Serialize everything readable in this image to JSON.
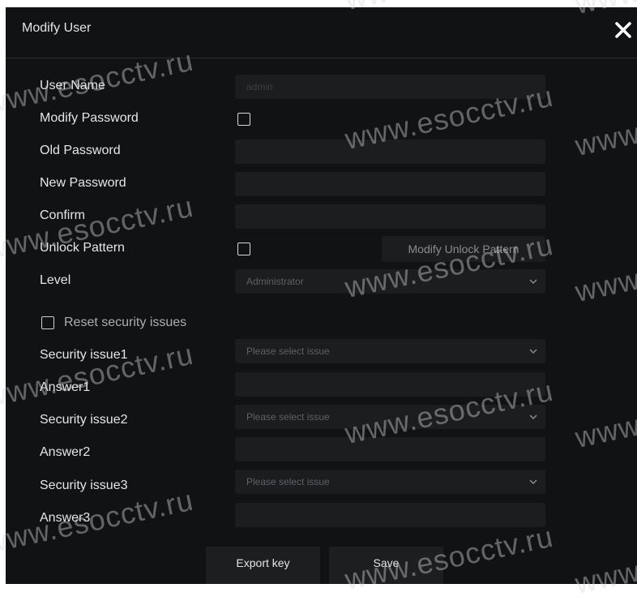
{
  "dialog": {
    "title": "Modify User",
    "fields": {
      "user_name": {
        "label": "User Name",
        "value": "admin"
      },
      "modify_password": {
        "label": "Modify Password"
      },
      "old_password": {
        "label": "Old Password",
        "value": ""
      },
      "new_password": {
        "label": "New Password",
        "value": ""
      },
      "confirm": {
        "label": "Confirm",
        "value": ""
      },
      "unlock_pattern": {
        "label": "Unlock Pattern",
        "button_label": "Modify Unlock Pattern"
      },
      "level": {
        "label": "Level",
        "value": "Administrator"
      },
      "reset_security": {
        "label": "Reset security issues"
      },
      "security_issue1": {
        "label": "Security issue1",
        "value": "Please select issue"
      },
      "answer1": {
        "label": "Answer1",
        "value": ""
      },
      "security_issue2": {
        "label": "Security issue2",
        "value": "Please select issue"
      },
      "answer2": {
        "label": "Answer2",
        "value": ""
      },
      "security_issue3": {
        "label": "Security issue3",
        "value": "Please select issue"
      },
      "answer3": {
        "label": "Answer3",
        "value": ""
      }
    },
    "buttons": {
      "export_key": "Export key",
      "save": "Save"
    }
  },
  "watermark": "www.esocctv.ru",
  "colors": {
    "background": "#111213",
    "field": "#1c1d1f",
    "text": "#e6e6e6"
  }
}
